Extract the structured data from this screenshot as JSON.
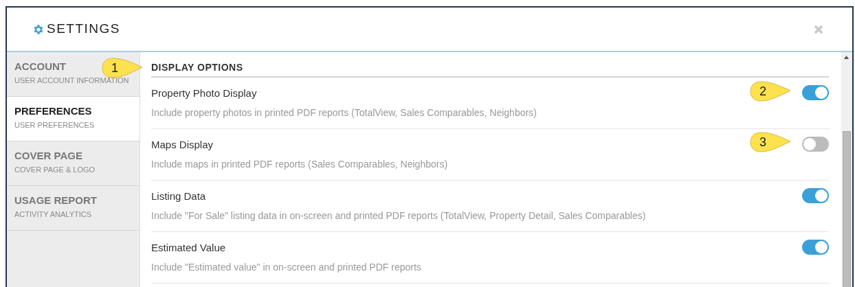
{
  "window": {
    "title": "SETTINGS"
  },
  "sidebar": {
    "items": [
      {
        "title": "ACCOUNT",
        "subtitle": "USER ACCOUNT INFORMATION",
        "selected": false
      },
      {
        "title": "PREFERENCES",
        "subtitle": "USER PREFERENCES",
        "selected": true
      },
      {
        "title": "COVER PAGE",
        "subtitle": "COVER PAGE & LOGO",
        "selected": false
      },
      {
        "title": "USAGE REPORT",
        "subtitle": "ACTIVITY ANALYTICS",
        "selected": false
      }
    ]
  },
  "section": {
    "heading": "DISPLAY OPTIONS",
    "options": [
      {
        "title": "Property Photo Display",
        "description": "Include property photos in printed PDF reports (TotalView, Sales Comparables, Neighbors)",
        "on": true
      },
      {
        "title": "Maps Display",
        "description": "Include maps in printed PDF reports (Sales Comparables, Neighbors)",
        "on": false
      },
      {
        "title": "Listing Data",
        "description": "Include \"For Sale\" listing data in on-screen and printed PDF reports (TotalView, Property Detail, Sales Comparables)",
        "on": true
      },
      {
        "title": "Estimated Value",
        "description": "Include \"Estimated value\" in on-screen and printed PDF reports",
        "on": true
      }
    ]
  },
  "callouts": [
    {
      "label": "1"
    },
    {
      "label": "2"
    },
    {
      "label": "3"
    }
  ]
}
